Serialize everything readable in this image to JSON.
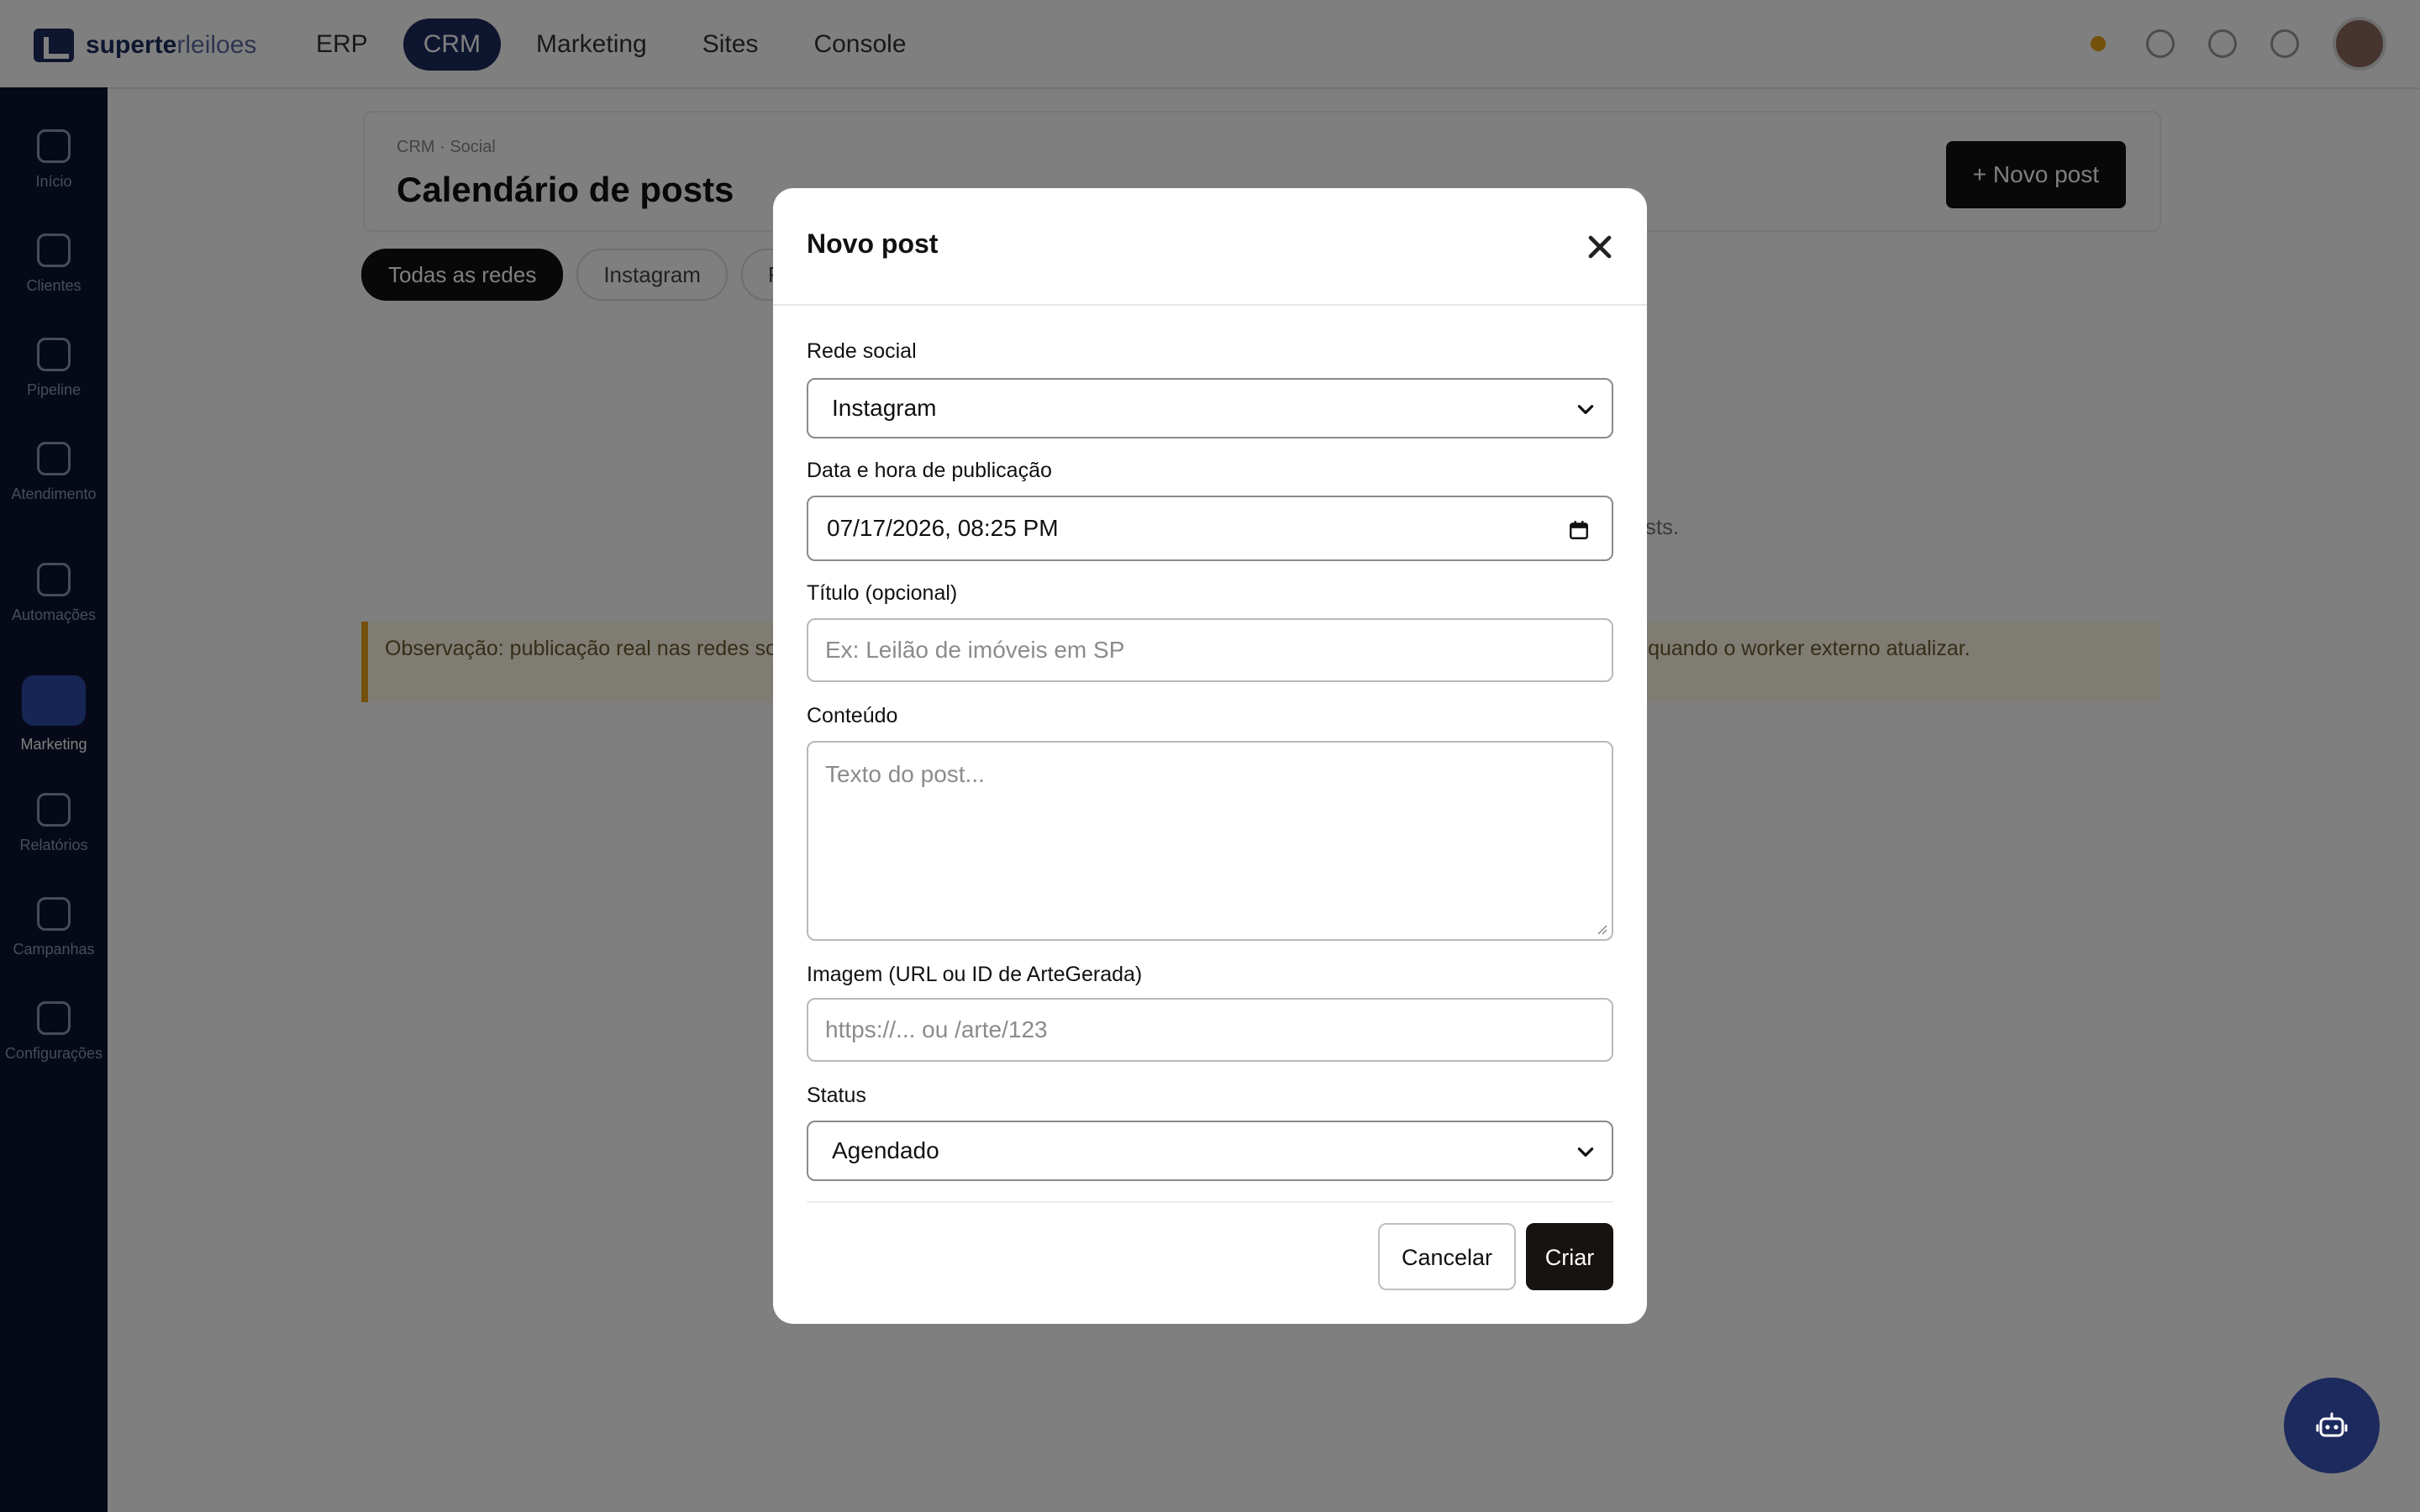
{
  "topnav": {
    "logo_brand": "superte",
    "logo_suffix": "rleiloes",
    "items": [
      {
        "label": "ERP",
        "active": false
      },
      {
        "label": "CRM",
        "active": true
      },
      {
        "label": "Marketing",
        "active": false
      },
      {
        "label": "Sites",
        "active": false
      },
      {
        "label": "Console",
        "active": false
      }
    ]
  },
  "sidebar": {
    "items": [
      {
        "label": "Início",
        "active": false
      },
      {
        "label": "Clientes",
        "active": false
      },
      {
        "label": "Pipeline",
        "active": false
      },
      {
        "label": "Atendimento",
        "active": false
      },
      {
        "label": "Automações",
        "active": false
      },
      {
        "label": "Marketing",
        "active": true
      },
      {
        "label": "Relatórios",
        "active": false
      },
      {
        "label": "Campanhas",
        "active": false
      },
      {
        "label": "Configurações",
        "active": false
      }
    ]
  },
  "page": {
    "breadcrumb": "CRM · Social",
    "title": "Calendário de posts",
    "new_post_label": "+ Novo post",
    "filters": [
      {
        "label": "Todas as redes",
        "active": true
      },
      {
        "label": "Instagram",
        "active": false
      },
      {
        "label": "Facebook",
        "active": false
      }
    ],
    "empty_text": "... posts.",
    "note_text": "Observação: publicação real nas redes sociais depende da configuração das integrações. Status \"publicando\" e \"publicado\" só mudam quando o worker externo atualizar."
  },
  "modal": {
    "title": "Novo post",
    "fields": {
      "network": {
        "label": "Rede social",
        "value": "Instagram"
      },
      "datetime": {
        "label": "Data e hora de publicação",
        "value": "07/17/2026, 08:25 PM"
      },
      "title": {
        "label": "Título (opcional)",
        "placeholder": "Ex: Leilão de imóveis em SP"
      },
      "content": {
        "label": "Conteúdo",
        "placeholder": "Texto do post..."
      },
      "image": {
        "label": "Imagem (URL ou ID de ArteGerada)",
        "placeholder": "https://... ou /arte/123"
      },
      "status": {
        "label": "Status",
        "value": "Agendado"
      }
    },
    "cancel_label": "Cancelar",
    "create_label": "Criar"
  },
  "colors": {
    "brand_navy": "#1d2a5e",
    "sidebar_bg": "#0d1530",
    "primary_button": "#161310",
    "note_accent": "#e8a317"
  },
  "icons": {
    "close": "close-icon",
    "chevron": "chevron-down-icon",
    "calendar": "calendar-icon",
    "assistant": "robot-icon"
  }
}
